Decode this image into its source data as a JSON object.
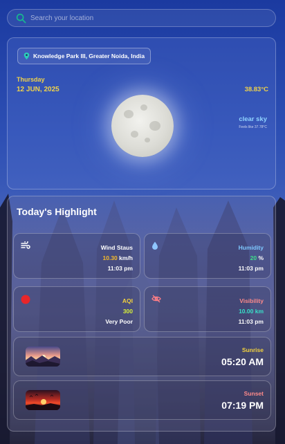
{
  "search": {
    "placeholder": "Search your location",
    "value": ""
  },
  "weather": {
    "location": "Knowledge Park III, Greater Noida, India",
    "day": "Thursday",
    "date": "12 JUN, 2025",
    "temperature": "38.83°C",
    "condition": "clear sky",
    "feels_like": "Feels like 37.78°C",
    "icon": "full-moon-icon"
  },
  "highlight": {
    "title": "Today's Highlight",
    "wind": {
      "label": "Wind Staus",
      "value": "10.30",
      "unit": "km/h",
      "time": "11:03 pm",
      "icon": "wind-icon"
    },
    "humidity": {
      "label": "Humidity",
      "value": "20",
      "unit": "%",
      "time": "11:03 pm",
      "icon": "droplet-icon"
    },
    "aqi": {
      "label": "AQI",
      "value": "300",
      "status": "Very Poor",
      "time": "",
      "icon": "aqi-dot-icon",
      "dot_color": "#e8262a"
    },
    "visibility": {
      "label": "Visibility",
      "value": "10.00 km",
      "time": "11:03 pm",
      "icon": "eye-off-icon"
    },
    "sunrise": {
      "label": "Sunrise",
      "time": "05:20 AM"
    },
    "sunset": {
      "label": "Sunset",
      "time": "07:19 PM"
    }
  },
  "colors": {
    "accent_yellow": "#f0d24a",
    "sky_blue": "#8fd3ff",
    "humidity_green": "#3ee08a",
    "visibility_aqua": "#38e0c8",
    "sunset_red": "#ff8a8a"
  }
}
